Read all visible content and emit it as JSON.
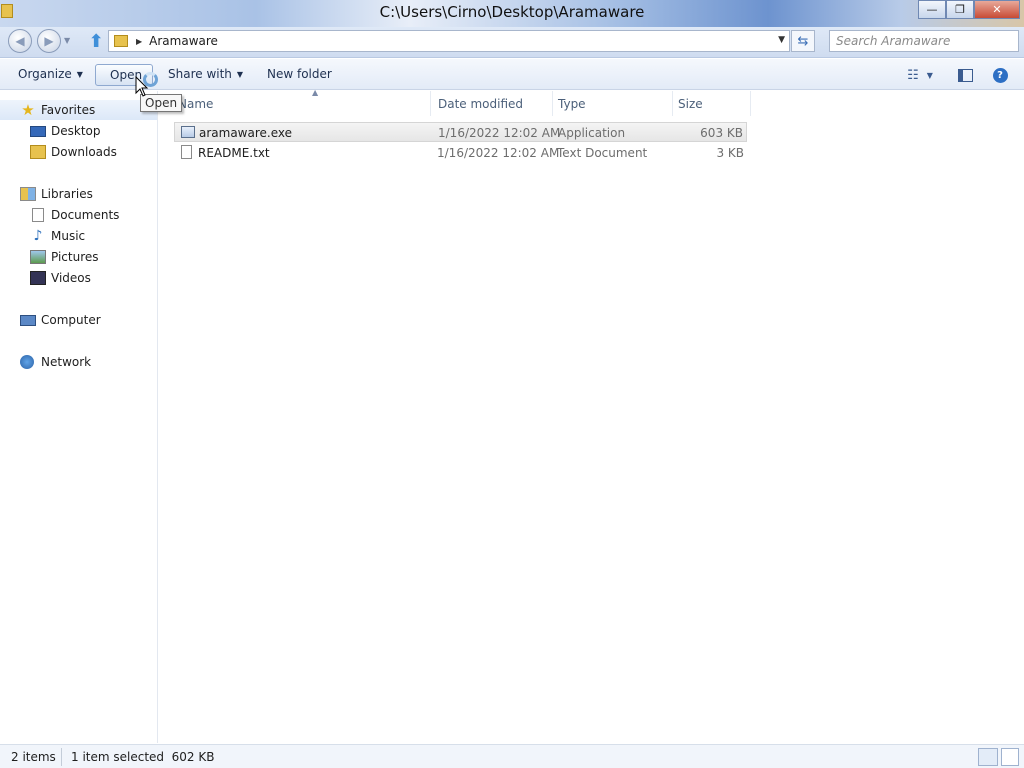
{
  "window": {
    "title": "C:\\Users\\Cirno\\Desktop\\Aramaware",
    "buttons": {
      "minimize": "—",
      "maximize": "❐",
      "close": "✕"
    }
  },
  "address": {
    "crumb": "Aramaware",
    "search_placeholder": "Search Aramaware"
  },
  "toolbar": {
    "organize": "Organize",
    "open": "Open",
    "share_with": "Share with",
    "new_folder": "New folder"
  },
  "tooltip": "Open",
  "nav": {
    "favorites": "Favorites",
    "desktop": "Desktop",
    "downloads": "Downloads",
    "libraries": "Libraries",
    "documents": "Documents",
    "music": "Music",
    "pictures": "Pictures",
    "videos": "Videos",
    "computer": "Computer",
    "network": "Network"
  },
  "columns": {
    "name": "Name",
    "date": "Date modified",
    "type": "Type",
    "size": "Size"
  },
  "files": [
    {
      "name": "aramaware.exe",
      "date": "1/16/2022 12:02 AM",
      "type": "Application",
      "size": "603 KB",
      "icon": "application-icon",
      "selected": true
    },
    {
      "name": "README.txt",
      "date": "1/16/2022 12:02 AM",
      "type": "Text Document",
      "size": "3 KB",
      "icon": "text-file-icon",
      "selected": false
    }
  ],
  "status": {
    "items": "2 items",
    "selection": "1 item selected  602 KB"
  }
}
